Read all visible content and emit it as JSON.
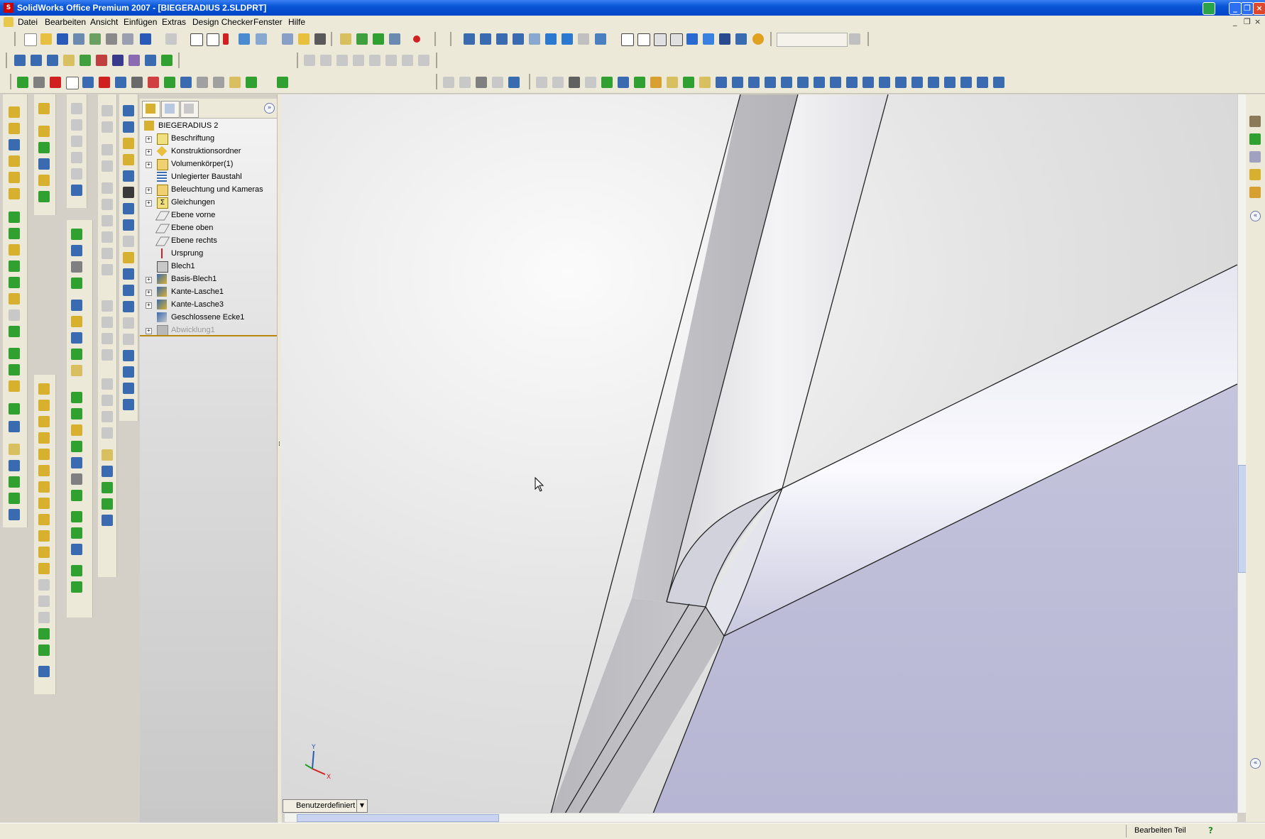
{
  "window": {
    "title": "SolidWorks Office Premium 2007 - [BIEGERADIUS 2.SLDPRT]",
    "app_icon": "solidworks-logo-icon",
    "controls": [
      "minimize",
      "maximize",
      "close"
    ]
  },
  "menu": {
    "items": [
      "Datei",
      "Bearbeiten",
      "Ansicht",
      "Einfügen",
      "Extras",
      "Design Checker",
      "Fenster",
      "Hilfe"
    ],
    "doc_controls": [
      "_",
      "❐",
      "×"
    ]
  },
  "feature_manager": {
    "tabs": [
      "featuremanager-tab",
      "propertymanager-tab",
      "configurationmanager-tab"
    ],
    "root": "BIEGERADIUS 2",
    "items": [
      {
        "label": "Beschriftung",
        "expandable": true,
        "icon": "annotations-icon"
      },
      {
        "label": "Konstruktionsordner",
        "expandable": true,
        "icon": "design-binder-icon"
      },
      {
        "label": "Volumenkörper(1)",
        "expandable": true,
        "icon": "solid-bodies-icon"
      },
      {
        "label": "Unlegierter Baustahl",
        "expandable": false,
        "icon": "material-icon"
      },
      {
        "label": "Beleuchtung und Kameras",
        "expandable": true,
        "icon": "lights-cameras-icon"
      },
      {
        "label": "Gleichungen",
        "expandable": true,
        "icon": "equations-icon"
      },
      {
        "label": "Ebene vorne",
        "expandable": false,
        "icon": "plane-icon"
      },
      {
        "label": "Ebene oben",
        "expandable": false,
        "icon": "plane-icon"
      },
      {
        "label": "Ebene rechts",
        "expandable": false,
        "icon": "plane-icon"
      },
      {
        "label": "Ursprung",
        "expandable": false,
        "icon": "origin-icon"
      },
      {
        "label": "Blech1",
        "expandable": false,
        "icon": "sheet-metal-icon"
      },
      {
        "label": "Basis-Blech1",
        "expandable": true,
        "icon": "base-flange-icon"
      },
      {
        "label": "Kante-Lasche1",
        "expandable": true,
        "icon": "edge-flange-icon"
      },
      {
        "label": "Kante-Lasche3",
        "expandable": true,
        "icon": "edge-flange-icon"
      },
      {
        "label": "Geschlossene Ecke1",
        "expandable": false,
        "icon": "closed-corner-icon"
      },
      {
        "label": "Abwicklung1",
        "expandable": true,
        "icon": "flat-pattern-icon",
        "suppressed": true
      }
    ]
  },
  "viewport": {
    "view_orientation": "Benutzerdefiniert",
    "triad": {
      "x": "X",
      "y": "Y"
    },
    "model_colors": {
      "face_light": "#f0f0f4",
      "face_mid": "#cfcfd6",
      "face_blue": "#b8b8d8",
      "edge": "#202020"
    }
  },
  "status": {
    "mode": "Bearbeiten Teil",
    "help": "?"
  }
}
